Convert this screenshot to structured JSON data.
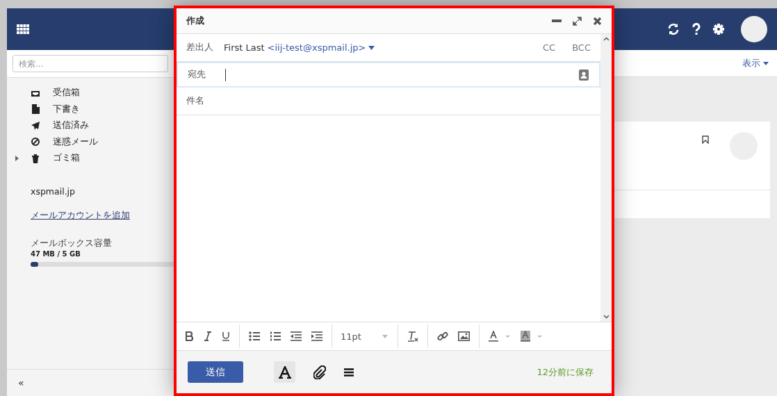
{
  "search": {
    "placeholder": "検索..."
  },
  "folders": [
    {
      "kind": "inbox",
      "label": "受信箱",
      "expandable": false
    },
    {
      "kind": "drafts",
      "label": "下書き",
      "expandable": false
    },
    {
      "kind": "sent",
      "label": "送信済み",
      "expandable": false
    },
    {
      "kind": "spam",
      "label": "迷惑メール",
      "expandable": false
    },
    {
      "kind": "trash",
      "label": "ゴミ箱",
      "expandable": true
    }
  ],
  "account": "xspmail.jp",
  "add_account_link": "メールアカウントを追加",
  "quota": {
    "label": "メールボックス容量",
    "usage": "47 MB / 5 GB",
    "level": 0.05
  },
  "collapse_button": "«",
  "view_menu": "表示",
  "compose": {
    "title": "作成",
    "from_label": "差出人",
    "from_name": "First Last",
    "from_address": "<iij-test@xspmail.jp>",
    "cc": "CC",
    "bcc": "BCC",
    "to_label": "宛先",
    "subject_label": "件名",
    "font_size": "11pt",
    "send": "送信",
    "formatting": {
      "on": true
    },
    "saved_status": "12分前に保存"
  }
}
